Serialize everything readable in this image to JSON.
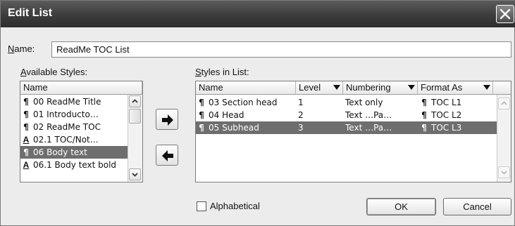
{
  "window": {
    "title": "Edit List",
    "close_icon": "close-icon"
  },
  "name_field": {
    "label_key": "N",
    "label_rest": "ame:",
    "value": "ReadMe TOC List"
  },
  "available": {
    "label_key": "A",
    "label_rest": "vailable Styles:",
    "column": "Name",
    "items": [
      {
        "symbol": "¶",
        "kind": "paragraph",
        "text": "00 ReadMe Title",
        "selected": false
      },
      {
        "symbol": "¶",
        "kind": "paragraph",
        "text": "01 Introducto…",
        "selected": false
      },
      {
        "symbol": "¶",
        "kind": "paragraph",
        "text": "02 ReadMe TOC",
        "selected": false
      },
      {
        "symbol": "A",
        "kind": "character",
        "text": "02.1 TOC/Not…",
        "selected": false
      },
      {
        "symbol": "¶",
        "kind": "paragraph",
        "text": "06 Body text",
        "selected": true
      },
      {
        "symbol": "A",
        "kind": "character",
        "text": "06.1 Body text bold",
        "selected": false
      }
    ]
  },
  "in_list": {
    "label_key": "S",
    "label_rest": "tyles in List:",
    "columns": [
      "Name",
      "Level",
      "Numbering",
      "Format As"
    ],
    "rows": [
      {
        "name": "03 Section head",
        "level": "1",
        "numbering": "Text only",
        "format_as": "TOC L1",
        "selected": false
      },
      {
        "name": "04 Head",
        "level": "2",
        "numbering": "Text …Pa…",
        "format_as": "TOC L2",
        "selected": false
      },
      {
        "name": "05 Subhead",
        "level": "3",
        "numbering": "Text …Pa…",
        "format_as": "TOC L3",
        "selected": true
      }
    ]
  },
  "buttons": {
    "add_icon": "arrow-right-icon",
    "remove_icon": "arrow-left-icon",
    "ok": "OK",
    "cancel": "Cancel"
  },
  "alphabetical": {
    "label": "Alphabetical",
    "checked": false
  },
  "colors": {
    "selection": "#6e6e6e",
    "titlebar": "#3c3c3c"
  }
}
